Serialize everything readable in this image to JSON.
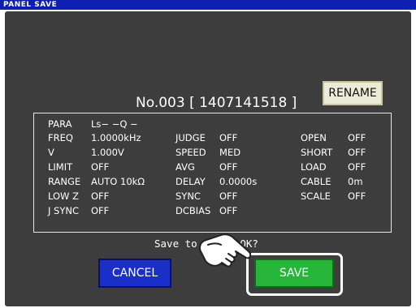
{
  "title_bar": "PANEL SAVE",
  "record": "No.003 [ 1407141518 ]",
  "rename_label": "RENAME",
  "params": {
    "para_label": "PARA",
    "para_value": "Ls−  −Q −",
    "freq_label": "FREQ",
    "freq_value": "1.0000kHz",
    "v_label": "V",
    "v_value": "1.000V",
    "limit_label": "LIMIT",
    "limit_value": "OFF",
    "range_label": "RANGE",
    "range_value": "AUTO  10kΩ",
    "lowz_label": "LOW Z",
    "lowz_value": "OFF",
    "jsync_label": "J SYNC",
    "jsync_value": "OFF",
    "judge_label": "JUDGE",
    "judge_value": "OFF",
    "speed_label": "SPEED",
    "speed_value": "MED",
    "avg_label": "AVG",
    "avg_value": "OFF",
    "delay_label": "DELAY",
    "delay_value": "0.0000s",
    "sync_label": "SYNC",
    "sync_value": "OFF",
    "dcbias_label": "DCBIAS",
    "dcbias_value": "OFF",
    "open_label": "OPEN",
    "open_value": "OFF",
    "short_label": "SHORT",
    "short_value": "OFF",
    "load_label": "LOAD",
    "load_value": "OFF",
    "cable_label": "CABLE",
    "cable_value": "0m",
    "scale_label": "SCALE",
    "scale_value": "OFF"
  },
  "confirm_text": "Save to panel OK?",
  "cancel_label": "CANCEL",
  "save_label": "SAVE",
  "pointer_icon": "pointing-hand-icon"
}
